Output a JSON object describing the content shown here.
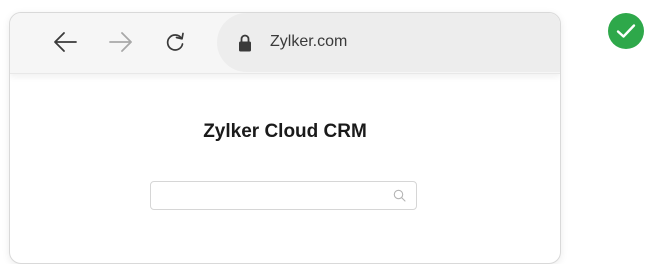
{
  "browser": {
    "url": "Zylker.com",
    "nav_icons": [
      "back-arrow-icon",
      "forward-arrow-icon",
      "reload-icon",
      "lock-icon"
    ]
  },
  "page": {
    "title": "Zylker Cloud CRM",
    "search": {
      "value": "",
      "placeholder": "",
      "icon": "search-icon"
    }
  },
  "status": {
    "icon": "checkmark-icon",
    "color": "#2ea84a"
  }
}
